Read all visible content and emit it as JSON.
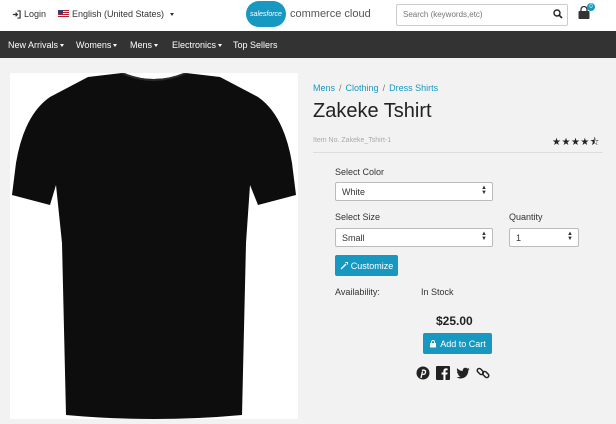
{
  "header": {
    "login_label": "Login",
    "language_label": "English (United States)",
    "logo_small": "salesforce",
    "logo_text": "commerce cloud",
    "search_placeholder": "Search (keywords,etc)",
    "cart_count": "0",
    "accent_color": "#1798c1"
  },
  "nav": {
    "items": [
      {
        "label": "New Arrivals",
        "has_caret": true
      },
      {
        "label": "Womens",
        "has_caret": true
      },
      {
        "label": "Mens",
        "has_caret": true
      },
      {
        "label": "Electronics",
        "has_caret": true
      },
      {
        "label": "Top Sellers",
        "has_caret": false
      }
    ]
  },
  "breadcrumb": [
    "Mens",
    "Clothing",
    "Dress Shirts"
  ],
  "product": {
    "title": "Zakeke Tshirt",
    "item_no": "Item No. Zakeke_Tshirt-1",
    "rating": 4.5,
    "color_label": "Select Color",
    "color_value": "White",
    "size_label": "Select Size",
    "size_value": "Small",
    "quantity_label": "Quantity",
    "quantity_value": "1",
    "customize_label": "Customize",
    "availability_label": "Availability:",
    "availability_value": "In Stock",
    "price": "$25.00",
    "add_to_cart_label": "Add to Cart"
  },
  "social": [
    "pinterest-icon",
    "facebook-icon",
    "twitter-icon",
    "link-icon"
  ]
}
